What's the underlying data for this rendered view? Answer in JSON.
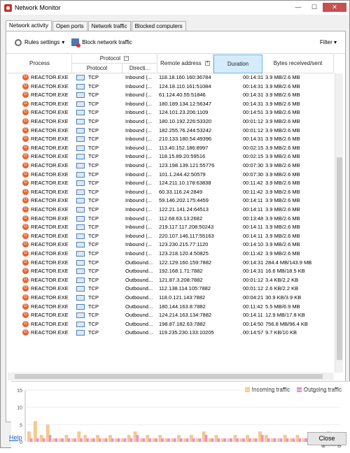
{
  "window": {
    "title": "Network Monitor",
    "min_glyph": "—",
    "max_glyph": "☐",
    "close_glyph": "✕"
  },
  "tabs": [
    {
      "label": "Network activity",
      "active": true
    },
    {
      "label": "Open ports",
      "active": false
    },
    {
      "label": "Network traffic",
      "active": false
    },
    {
      "label": "Blocked computers",
      "active": false
    }
  ],
  "toolbar": {
    "rules_label": "Rules settings",
    "block_label": "Block network traffic",
    "filter_label": "Filter"
  },
  "columns": {
    "process": "Process",
    "protocol_group": "Protocol",
    "protocol": "Protocol",
    "direction": "Directi...",
    "remote": "Remote address",
    "duration": "Duration",
    "bytes": "Bytes received/sent"
  },
  "rows": [
    {
      "process": "REACTOR.EXE",
      "protocol": "TCP",
      "direction": "Inbound (...",
      "remote": "118.18.160.160:36784",
      "duration": "00:14:31",
      "bytes": "3.9 MB/2.6 MB"
    },
    {
      "process": "REACTOR.EXE",
      "protocol": "TCP",
      "direction": "Inbound (...",
      "remote": "124.18.110.161:51084",
      "duration": "00:14:31",
      "bytes": "3.9 MB/2.6 MB"
    },
    {
      "process": "REACTOR.EXE",
      "protocol": "TCP",
      "direction": "Inbound (...",
      "remote": "61.124.40.55:51846",
      "duration": "00:14:31",
      "bytes": "3.9 MB/2.6 MB"
    },
    {
      "process": "REACTOR.EXE",
      "protocol": "TCP",
      "direction": "Inbound (...",
      "remote": "180.189.134.12:56347",
      "duration": "00:14:31",
      "bytes": "3.9 MB/2.6 MB"
    },
    {
      "process": "REACTOR.EXE",
      "protocol": "TCP",
      "direction": "Inbound (...",
      "remote": "124.101.23.206:1109",
      "duration": "00:14:51",
      "bytes": "3.9 MB/2.6 MB"
    },
    {
      "process": "REACTOR.EXE",
      "protocol": "TCP",
      "direction": "Inbound (...",
      "remote": "180.10.192.226:53320",
      "duration": "00:01:12",
      "bytes": "3.9 MB/2.6 MB"
    },
    {
      "process": "REACTOR.EXE",
      "protocol": "TCP",
      "direction": "Inbound (...",
      "remote": "182.255.76.244:53242",
      "duration": "00:01:12",
      "bytes": "3.9 MB/2.6 MB"
    },
    {
      "process": "REACTOR.EXE",
      "protocol": "TCP",
      "direction": "Inbound (...",
      "remote": "210.133.180.54:49396",
      "duration": "00:14:31",
      "bytes": "3.9 MB/2.6 MB"
    },
    {
      "process": "REACTOR.EXE",
      "protocol": "TCP",
      "direction": "Inbound (...",
      "remote": "113.40.152.186:8997",
      "duration": "00:02:15",
      "bytes": "3.9 MB/2.6 MB"
    },
    {
      "process": "REACTOR.EXE",
      "protocol": "TCP",
      "direction": "Inbound (...",
      "remote": "118.15.89.20:59516",
      "duration": "00:02:15",
      "bytes": "3.9 MB/2.6 MB"
    },
    {
      "process": "REACTOR.EXE",
      "protocol": "TCP",
      "direction": "Inbound (...",
      "remote": "123.198.139.121:55776",
      "duration": "00:07:30",
      "bytes": "3.9 MB/2.6 MB"
    },
    {
      "process": "REACTOR.EXE",
      "protocol": "TCP",
      "direction": "Inbound (...",
      "remote": "101.1.244.42:50579",
      "duration": "00:07:30",
      "bytes": "3.9 MB/2.6 MB"
    },
    {
      "process": "REACTOR.EXE",
      "protocol": "TCP",
      "direction": "Inbound (...",
      "remote": "124.211.10.178:63838",
      "duration": "00:11:42",
      "bytes": "3.9 MB/2.6 MB"
    },
    {
      "process": "REACTOR.EXE",
      "protocol": "TCP",
      "direction": "Inbound (...",
      "remote": "60.33.116.24:2849",
      "duration": "00:11:42",
      "bytes": "3.9 MB/2.6 MB"
    },
    {
      "process": "REACTOR.EXE",
      "protocol": "TCP",
      "direction": "Inbound (...",
      "remote": "59.146.202.175:4459",
      "duration": "00:14:11",
      "bytes": "3.9 MB/2.6 MB"
    },
    {
      "process": "REACTOR.EXE",
      "protocol": "TCP",
      "direction": "Inbound (...",
      "remote": "122.21.141.24:64513",
      "duration": "00:14:11",
      "bytes": "3.9 MB/2.6 MB"
    },
    {
      "process": "REACTOR.EXE",
      "protocol": "TCP",
      "direction": "Inbound (...",
      "remote": "112.68.63.13:2682",
      "duration": "00:13:48",
      "bytes": "3.9 MB/2.6 MB"
    },
    {
      "process": "REACTOR.EXE",
      "protocol": "TCP",
      "direction": "Inbound (...",
      "remote": "219.117.117.208:50243",
      "duration": "00:14:11",
      "bytes": "3.9 MB/2.6 MB"
    },
    {
      "process": "REACTOR.EXE",
      "protocol": "TCP",
      "direction": "Inbound (...",
      "remote": "220.107.146.117:55163",
      "duration": "00:14:11",
      "bytes": "3.9 MB/2.6 MB"
    },
    {
      "process": "REACTOR.EXE",
      "protocol": "TCP",
      "direction": "Inbound (...",
      "remote": "123.230.215.77:1120",
      "duration": "00:14:10",
      "bytes": "3.9 MB/2.6 MB"
    },
    {
      "process": "REACTOR.EXE",
      "protocol": "TCP",
      "direction": "Inbound (...",
      "remote": "123.218.120.4:50825",
      "duration": "00:11:42",
      "bytes": "3.9 MB/2.6 MB"
    },
    {
      "process": "REACTOR.EXE",
      "protocol": "TCP",
      "direction": "Outbound...",
      "remote": "122.129.160.159:7882",
      "duration": "00:14:31",
      "bytes": "284.4 MB/143.9 MB"
    },
    {
      "process": "REACTOR.EXE",
      "protocol": "TCP",
      "direction": "Outbound...",
      "remote": "192.168.1.71:7882",
      "duration": "00:14:31",
      "bytes": "16.6 MB/18.5 KB"
    },
    {
      "process": "REACTOR.EXE",
      "protocol": "TCP",
      "direction": "Outbound...",
      "remote": "121.87.3.208:7882",
      "duration": "00:01:12",
      "bytes": "3.4 KB/2.2 KB"
    },
    {
      "process": "REACTOR.EXE",
      "protocol": "TCP",
      "direction": "Outbound...",
      "remote": "112.138.114.105:7882",
      "duration": "00:01:12",
      "bytes": "2.6 KB/2.2 KB"
    },
    {
      "process": "REACTOR.EXE",
      "protocol": "TCP",
      "direction": "Outbound...",
      "remote": "118.0.121.143:7882",
      "duration": "00:04:21",
      "bytes": "30.9 KB/3.9 KB"
    },
    {
      "process": "REACTOR.EXE",
      "protocol": "TCP",
      "direction": "Outbound...",
      "remote": "180.144.163.8:7882",
      "duration": "00:11:42",
      "bytes": "5.5 MB/6.9 MB"
    },
    {
      "process": "REACTOR.EXE",
      "protocol": "TCP",
      "direction": "Outbound...",
      "remote": "124.214.163.134:7882",
      "duration": "00:14:11",
      "bytes": "12.9 MB/17.8 KB"
    },
    {
      "process": "REACTOR.EXE",
      "protocol": "TCP",
      "direction": "Outbound...",
      "remote": "198.87.182.63:7882",
      "duration": "00:14:50",
      "bytes": "756.8 MB/96.4 KB"
    },
    {
      "process": "REACTOR.EXE",
      "protocol": "TCP",
      "direction": "Outbound...",
      "remote": "119.235.230.133:10205",
      "duration": "00:14:57",
      "bytes": "9.7 KB/10 KB"
    }
  ],
  "chart": {
    "legend_incoming": "Incoming traffic",
    "legend_outgoing": "Outgoing traffic",
    "y_ticks": [
      "15",
      "10",
      "5",
      "0"
    ],
    "zoom_text": "⊕——⊖",
    "incoming_color": "#f6c98b",
    "outgoing_color": "#e78fd6"
  },
  "chart_data": {
    "type": "bar",
    "ylim": [
      0,
      15
    ],
    "series": [
      {
        "name": "Incoming traffic",
        "values": [
          3,
          6,
          2,
          5,
          1,
          1,
          2,
          1,
          3,
          2,
          1,
          2,
          1,
          2,
          1,
          1,
          2,
          3,
          1,
          2,
          1,
          2,
          1,
          1,
          2,
          1,
          2,
          1,
          3,
          1,
          2,
          1,
          1,
          2,
          1,
          2,
          1,
          3,
          2,
          1,
          1,
          2,
          1,
          2,
          1,
          1,
          2,
          1,
          3,
          1
        ]
      },
      {
        "name": "Outgoing traffic",
        "values": [
          1,
          1,
          1,
          2,
          1,
          1,
          1,
          1,
          1,
          1,
          1,
          1,
          1,
          1,
          1,
          1,
          1,
          2,
          1,
          1,
          1,
          1,
          1,
          1,
          1,
          1,
          1,
          1,
          2,
          1,
          1,
          1,
          1,
          1,
          1,
          1,
          1,
          2,
          1,
          1,
          1,
          1,
          1,
          1,
          1,
          1,
          2,
          1,
          1,
          1
        ]
      }
    ]
  },
  "footer": {
    "help": "Help",
    "close": "Close"
  }
}
